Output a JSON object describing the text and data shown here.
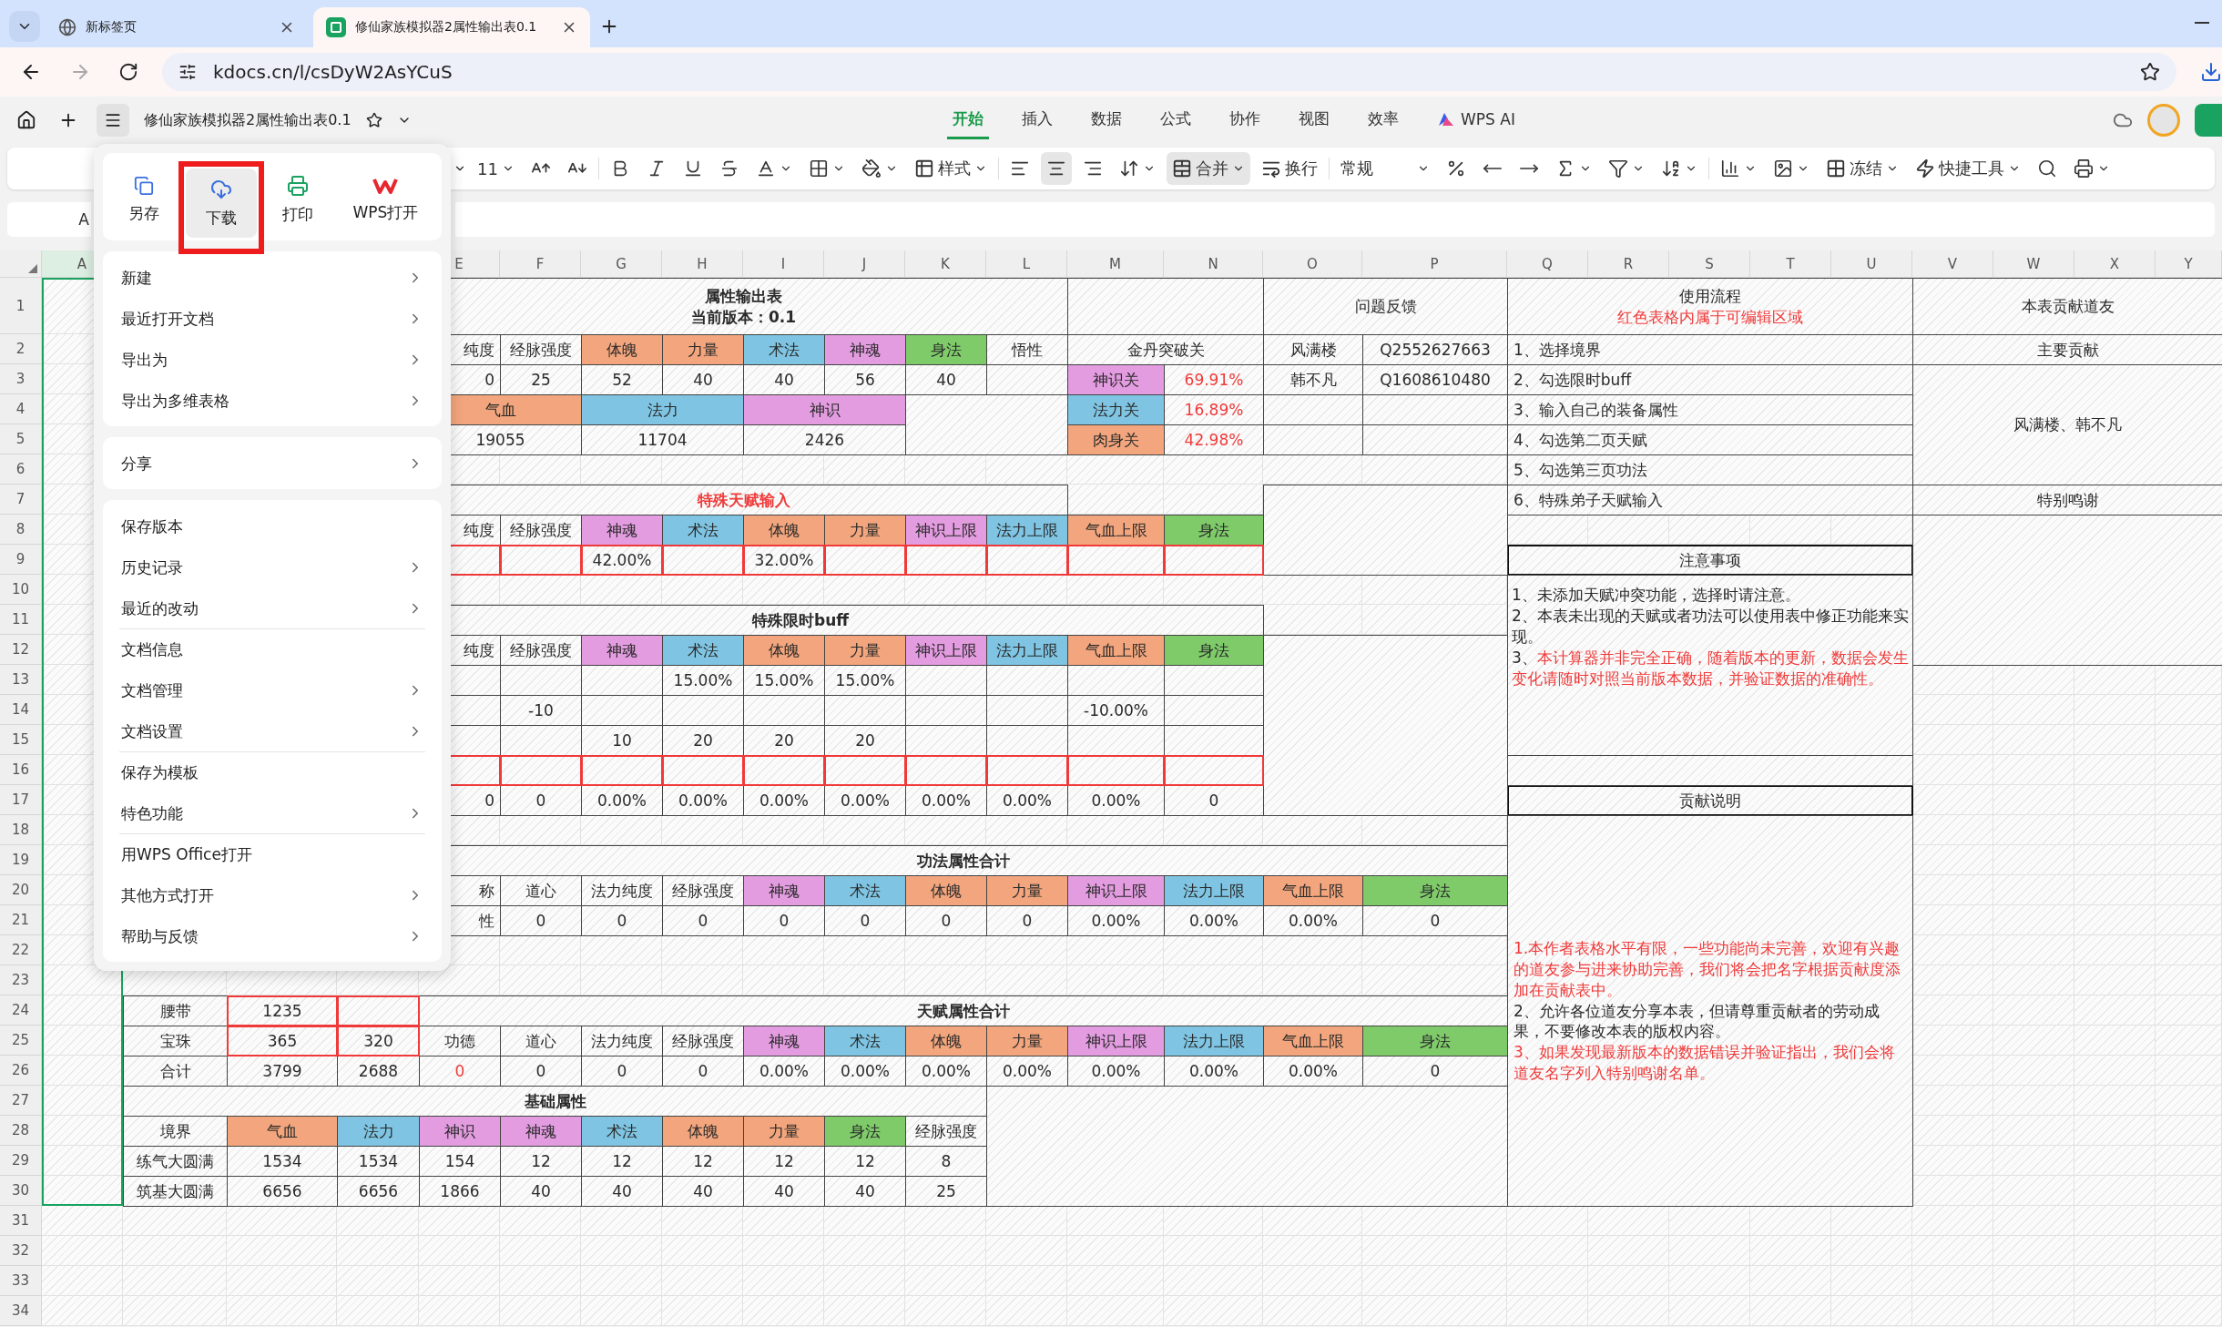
{
  "browser": {
    "tabs": [
      {
        "title": "新标签页",
        "selected": false,
        "kind": "newtab"
      },
      {
        "title": "修仙家族模拟器2属性输出表0.1",
        "selected": true,
        "kind": "sheet"
      }
    ],
    "url": "kdocs.cn/l/csDyW2AsYCuS"
  },
  "document": {
    "title": "修仙家族模拟器2属性输出表0.1",
    "ribbon_tabs": [
      {
        "label": "开始",
        "selected": true,
        "kind": "plain"
      },
      {
        "label": "插入",
        "selected": false,
        "kind": "plain"
      },
      {
        "label": "数据",
        "selected": false,
        "kind": "plain"
      },
      {
        "label": "公式",
        "selected": false,
        "kind": "plain"
      },
      {
        "label": "协作",
        "selected": false,
        "kind": "plain"
      },
      {
        "label": "视图",
        "selected": false,
        "kind": "plain"
      },
      {
        "label": "效率",
        "selected": false,
        "kind": "plain"
      },
      {
        "label": "WPS AI",
        "selected": false,
        "kind": "ai"
      }
    ]
  },
  "toolbar": {
    "font_size": "11",
    "style_label": "样式",
    "align": [
      {
        "selected": false
      },
      {
        "selected": true
      },
      {
        "selected": false
      }
    ],
    "merge": {
      "label": "合并",
      "selected": true
    },
    "wrap_label": "换行",
    "number_format": "常规",
    "freeze_label": "冻结",
    "quick_tools_label": "快捷工具"
  },
  "formula_bar": {
    "name_box": "A"
  },
  "menu": {
    "actions": [
      {
        "label": "另存",
        "highlighted": false
      },
      {
        "label": "下载",
        "highlighted": true
      },
      {
        "label": "打印",
        "highlighted": false
      },
      {
        "label": "WPS打开",
        "highlighted": false
      }
    ],
    "sections": [
      {
        "items": [
          {
            "label": "新建",
            "submenu": true,
            "divider_before": false
          },
          {
            "label": "最近打开文档",
            "submenu": true,
            "divider_before": false
          },
          {
            "label": "导出为",
            "submenu": true,
            "divider_before": false
          },
          {
            "label": "导出为多维表格",
            "submenu": true,
            "divider_before": false
          }
        ]
      },
      {
        "items": [
          {
            "label": "分享",
            "submenu": true,
            "divider_before": false
          }
        ]
      },
      {
        "items": [
          {
            "label": "保存版本",
            "submenu": false,
            "divider_before": false
          },
          {
            "label": "历史记录",
            "submenu": true,
            "divider_before": false
          },
          {
            "label": "最近的改动",
            "submenu": true,
            "divider_before": false
          },
          {
            "label": "文档信息",
            "submenu": false,
            "divider_before": true
          },
          {
            "label": "文档管理",
            "submenu": true,
            "divider_before": false
          },
          {
            "label": "文档设置",
            "submenu": true,
            "divider_before": false
          },
          {
            "label": "保存为模板",
            "submenu": false,
            "divider_before": true
          },
          {
            "label": "特色功能",
            "submenu": true,
            "divider_before": false
          },
          {
            "label": "用WPS Office打开",
            "submenu": false,
            "divider_before": true
          },
          {
            "label": "其他方式打开",
            "submenu": true,
            "divider_before": false
          },
          {
            "label": "帮助与反馈",
            "submenu": true,
            "divider_before": false
          }
        ]
      }
    ]
  },
  "sheet": {
    "column_headers": [
      {
        "label": "A",
        "selected": true
      },
      {
        "label": "E",
        "selected": false
      },
      {
        "label": "F",
        "selected": false
      },
      {
        "label": "G",
        "selected": false
      },
      {
        "label": "H",
        "selected": false
      },
      {
        "label": "I",
        "selected": false
      },
      {
        "label": "J",
        "selected": false
      },
      {
        "label": "K",
        "selected": false
      },
      {
        "label": "L",
        "selected": false
      },
      {
        "label": "M",
        "selected": false
      },
      {
        "label": "N",
        "selected": false
      },
      {
        "label": "O",
        "selected": false
      },
      {
        "label": "P",
        "selected": false
      },
      {
        "label": "Q",
        "selected": false
      },
      {
        "label": "R",
        "selected": false
      },
      {
        "label": "S",
        "selected": false
      },
      {
        "label": "T",
        "selected": false
      },
      {
        "label": "U",
        "selected": false
      },
      {
        "label": "V",
        "selected": false
      },
      {
        "label": "W",
        "selected": false
      },
      {
        "label": "X",
        "selected": false
      },
      {
        "label": "Y",
        "selected": false
      }
    ],
    "row_headers": [
      "1",
      "2",
      "3",
      "4",
      "5",
      "6",
      "7",
      "8",
      "9",
      "10",
      "11",
      "12",
      "13",
      "14",
      "15",
      "16",
      "17",
      "18",
      "19",
      "20",
      "21",
      "22",
      "23",
      "24",
      "25",
      "26",
      "27",
      "28",
      "29",
      "30",
      "31",
      "32",
      "33",
      "34"
    ],
    "cells": [
      {
        "bold": true,
        "lines": [
          {
            "text": "属性输出表",
            "red": false
          },
          {
            "text": "当前版本：0.1",
            "red": false
          }
        ]
      },
      {
        "text": "问题反馈"
      },
      {
        "lines": [
          {
            "text": "使用流程",
            "red": false
          },
          {
            "text": "红色表格内属于可编辑区域",
            "red": true
          }
        ]
      },
      {
        "text": "本表贡献道友"
      },
      {
        "text": "纯度"
      },
      {
        "text": "经脉强度"
      },
      {
        "text": "体魄",
        "color": "#f3a67d"
      },
      {
        "text": "力量",
        "color": "#f3a67d"
      },
      {
        "text": "术法",
        "color": "#7fc5e3"
      },
      {
        "text": "神魂",
        "color": "#e39ce0"
      },
      {
        "text": "身法",
        "color": "#7fcb6a"
      },
      {
        "text": "悟性"
      },
      {
        "text": "金丹突破关"
      },
      {
        "text": "风满楼"
      },
      {
        "text": "Q2552627663"
      },
      {
        "text": "1、选择境界"
      },
      {
        "text": "主要贡献"
      },
      {
        "text": "0"
      },
      {
        "text": "25"
      },
      {
        "text": "52"
      },
      {
        "text": "40"
      },
      {
        "text": "40"
      },
      {
        "text": "56"
      },
      {
        "text": "40"
      },
      {
        "text": "神识关",
        "color": "#e39ce0"
      },
      {
        "text": "69.91%",
        "red": true
      },
      {
        "text": "韩不凡"
      },
      {
        "text": "Q1608610480"
      },
      {
        "text": "2、勾选限时buff"
      },
      {
        "text": "风满楼、韩不凡"
      },
      {
        "text": "气血",
        "color": "#f3a67d"
      },
      {
        "text": "法力",
        "color": "#7fc5e3"
      },
      {
        "text": "神识",
        "color": "#e39ce0"
      },
      {
        "text": "法力关",
        "color": "#7fc5e3"
      },
      {
        "text": "16.89%",
        "red": true
      },
      {
        "text": "3、输入自己的装备属性"
      },
      {
        "text": "19055"
      },
      {
        "text": "11704"
      },
      {
        "text": "2426"
      },
      {
        "text": "肉身关",
        "color": "#f3a67d"
      },
      {
        "text": "42.98%",
        "red": true
      },
      {
        "text": "4、勾选第二页天赋"
      },
      {
        "text": "5、勾选第三页功法"
      },
      {
        "text": "特殊天赋输入",
        "bold": true,
        "red": true
      },
      {
        "text": "6、特殊弟子天赋输入"
      },
      {
        "text": "特别鸣谢"
      },
      {
        "text": "纯度"
      },
      {
        "text": "经脉强度"
      },
      {
        "text": "神魂",
        "color": "#e39ce0"
      },
      {
        "text": "术法",
        "color": "#7fc5e3"
      },
      {
        "text": "体魄",
        "color": "#f3a67d"
      },
      {
        "text": "力量",
        "color": "#f3a67d"
      },
      {
        "text": "神识上限",
        "color": "#e39ce0"
      },
      {
        "text": "法力上限",
        "color": "#7fc5e3"
      },
      {
        "text": "气血上限",
        "color": "#f3a67d"
      },
      {
        "text": "身法",
        "color": "#7fcb6a"
      },
      {
        "editable": true
      },
      {
        "editable": true
      },
      {
        "text": "42.00%",
        "editable": true
      },
      {
        "editable": true
      },
      {
        "text": "32.00%",
        "editable": true
      },
      {
        "editable": true
      },
      {
        "editable": true
      },
      {
        "editable": true
      },
      {
        "editable": true
      },
      {
        "editable": true
      },
      {
        "text": "注意事项",
        "thick": true
      },
      {
        "paragraphs": [
          {
            "segments": [
              {
                "text": "1、未添加天赋冲突功能，选择时请注意。",
                "red": false
              }
            ]
          },
          {
            "segments": [
              {
                "text": "2、本表未出现的天赋或者功法可以使用表中修正功能来实现。",
                "red": false
              }
            ]
          },
          {
            "segments": [
              {
                "text": "3、",
                "red": false
              },
              {
                "text": "本计算器并非完全正确，随着版本的更新，数据会发生变化请随时对照当前版本数据，并验证数据的准确性。",
                "red": true
              }
            ]
          }
        ]
      },
      {
        "text": "特殊限时buff",
        "bold": true
      },
      {
        "text": "纯度"
      },
      {
        "text": "经脉强度"
      },
      {
        "text": "神魂",
        "color": "#e39ce0"
      },
      {
        "text": "术法",
        "color": "#7fc5e3"
      },
      {
        "text": "体魄",
        "color": "#f3a67d"
      },
      {
        "text": "力量",
        "color": "#f3a67d"
      },
      {
        "text": "神识上限",
        "color": "#e39ce0"
      },
      {
        "text": "法力上限",
        "color": "#7fc5e3"
      },
      {
        "text": "气血上限",
        "color": "#f3a67d"
      },
      {
        "text": "身法",
        "color": "#7fcb6a"
      },
      {
        "text": "15.00%"
      },
      {
        "text": "15.00%"
      },
      {
        "text": "15.00%"
      },
      {
        "text": "-10"
      },
      {
        "text": "-10.00%"
      },
      {
        "text": "10"
      },
      {
        "text": "20"
      },
      {
        "text": "20"
      },
      {
        "text": "20"
      },
      {
        "editable": true
      },
      {
        "editable": true
      },
      {
        "editable": true
      },
      {
        "editable": true
      },
      {
        "editable": true
      },
      {
        "editable": true
      },
      {
        "editable": true
      },
      {
        "editable": true
      },
      {
        "editable": true
      },
      {
        "editable": true
      },
      {
        "text": "0"
      },
      {
        "text": "0"
      },
      {
        "text": "0.00%"
      },
      {
        "text": "0.00%"
      },
      {
        "text": "0.00%"
      },
      {
        "text": "0.00%"
      },
      {
        "text": "0.00%"
      },
      {
        "text": "0.00%"
      },
      {
        "text": "0.00%"
      },
      {
        "text": "0"
      },
      {
        "text": "贡献说明",
        "thick": true
      },
      {
        "paragraphs": [
          {
            "segments": [
              {
                "text": "1.本作者表格水平有限，一些功能尚未完善，欢迎有兴趣的道友参与进来协助完善，我们将会把名字根据贡献度添加在贡献表中。",
                "red": true
              }
            ]
          },
          {
            "segments": [
              {
                "text": "2、允许各位道友分享本表，但请尊重贡献者的劳动成果，不要修改本表的版权内容。",
                "red": false
              }
            ]
          },
          {
            "segments": [
              {
                "text": "3、如果发现最新版本的数据错误并验证指出，我们会将道友名字列入特别鸣谢名单。",
                "red": true
              }
            ]
          }
        ]
      },
      {
        "text": "功法属性合计",
        "bold": true
      },
      {
        "text": "称"
      },
      {
        "text": "道心"
      },
      {
        "text": "法力纯度"
      },
      {
        "text": "经脉强度"
      },
      {
        "text": "神魂",
        "color": "#e39ce0"
      },
      {
        "text": "术法",
        "color": "#7fc5e3"
      },
      {
        "text": "体魄",
        "color": "#f3a67d"
      },
      {
        "text": "力量",
        "color": "#f3a67d"
      },
      {
        "text": "神识上限",
        "color": "#e39ce0"
      },
      {
        "text": "法力上限",
        "color": "#7fc5e3"
      },
      {
        "text": "气血上限",
        "color": "#f3a67d"
      },
      {
        "text": "身法",
        "color": "#7fcb6a"
      },
      {
        "text": "性"
      },
      {
        "text": "0"
      },
      {
        "text": "0"
      },
      {
        "text": "0"
      },
      {
        "text": "0"
      },
      {
        "text": "0"
      },
      {
        "text": "0"
      },
      {
        "text": "0"
      },
      {
        "text": "0.00%"
      },
      {
        "text": "0.00%"
      },
      {
        "text": "0.00%"
      },
      {
        "text": "0"
      },
      {
        "text": "腰带"
      },
      {
        "text": "1235",
        "editable": true
      },
      {
        "editable": true
      },
      {
        "text": "天赋属性合计",
        "bold": true
      },
      {
        "text": "宝珠"
      },
      {
        "text": "365",
        "editable": true
      },
      {
        "text": "320",
        "editable": true
      },
      {
        "text": "功德"
      },
      {
        "text": "道心"
      },
      {
        "text": "法力纯度"
      },
      {
        "text": "经脉强度"
      },
      {
        "text": "神魂",
        "color": "#e39ce0"
      },
      {
        "text": "术法",
        "color": "#7fc5e3"
      },
      {
        "text": "体魄",
        "color": "#f3a67d"
      },
      {
        "text": "力量",
        "color": "#f3a67d"
      },
      {
        "text": "神识上限",
        "color": "#e39ce0"
      },
      {
        "text": "法力上限",
        "color": "#7fc5e3"
      },
      {
        "text": "气血上限",
        "color": "#f3a67d"
      },
      {
        "text": "身法",
        "color": "#7fcb6a"
      },
      {
        "text": "合计"
      },
      {
        "text": "3799"
      },
      {
        "text": "2688"
      },
      {
        "text": "0",
        "red": true
      },
      {
        "text": "0"
      },
      {
        "text": "0"
      },
      {
        "text": "0"
      },
      {
        "text": "0.00%"
      },
      {
        "text": "0.00%"
      },
      {
        "text": "0.00%"
      },
      {
        "text": "0.00%"
      },
      {
        "text": "0.00%"
      },
      {
        "text": "0.00%"
      },
      {
        "text": "0.00%"
      },
      {
        "text": "0"
      },
      {
        "text": "基础属性",
        "bold": true
      },
      {
        "text": "境界"
      },
      {
        "text": "气血",
        "color": "#f3a67d"
      },
      {
        "text": "法力",
        "color": "#7fc5e3"
      },
      {
        "text": "神识",
        "color": "#e39ce0"
      },
      {
        "text": "神魂",
        "color": "#e39ce0"
      },
      {
        "text": "术法",
        "color": "#7fc5e3"
      },
      {
        "text": "体魄",
        "color": "#f3a67d"
      },
      {
        "text": "力量",
        "color": "#f3a67d"
      },
      {
        "text": "身法",
        "color": "#7fcb6a"
      },
      {
        "text": "经脉强度"
      },
      {
        "text": "练气大圆满"
      },
      {
        "text": "1534"
      },
      {
        "text": "1534"
      },
      {
        "text": "154"
      },
      {
        "text": "12"
      },
      {
        "text": "12"
      },
      {
        "text": "12"
      },
      {
        "text": "12"
      },
      {
        "text": "12"
      },
      {
        "text": "8"
      },
      {
        "text": "筑基大圆满"
      },
      {
        "text": "6656"
      },
      {
        "text": "6656"
      },
      {
        "text": "1866"
      },
      {
        "text": "40"
      },
      {
        "text": "40"
      },
      {
        "text": "40"
      },
      {
        "text": "40"
      },
      {
        "text": "40"
      },
      {
        "text": "25"
      }
    ]
  }
}
